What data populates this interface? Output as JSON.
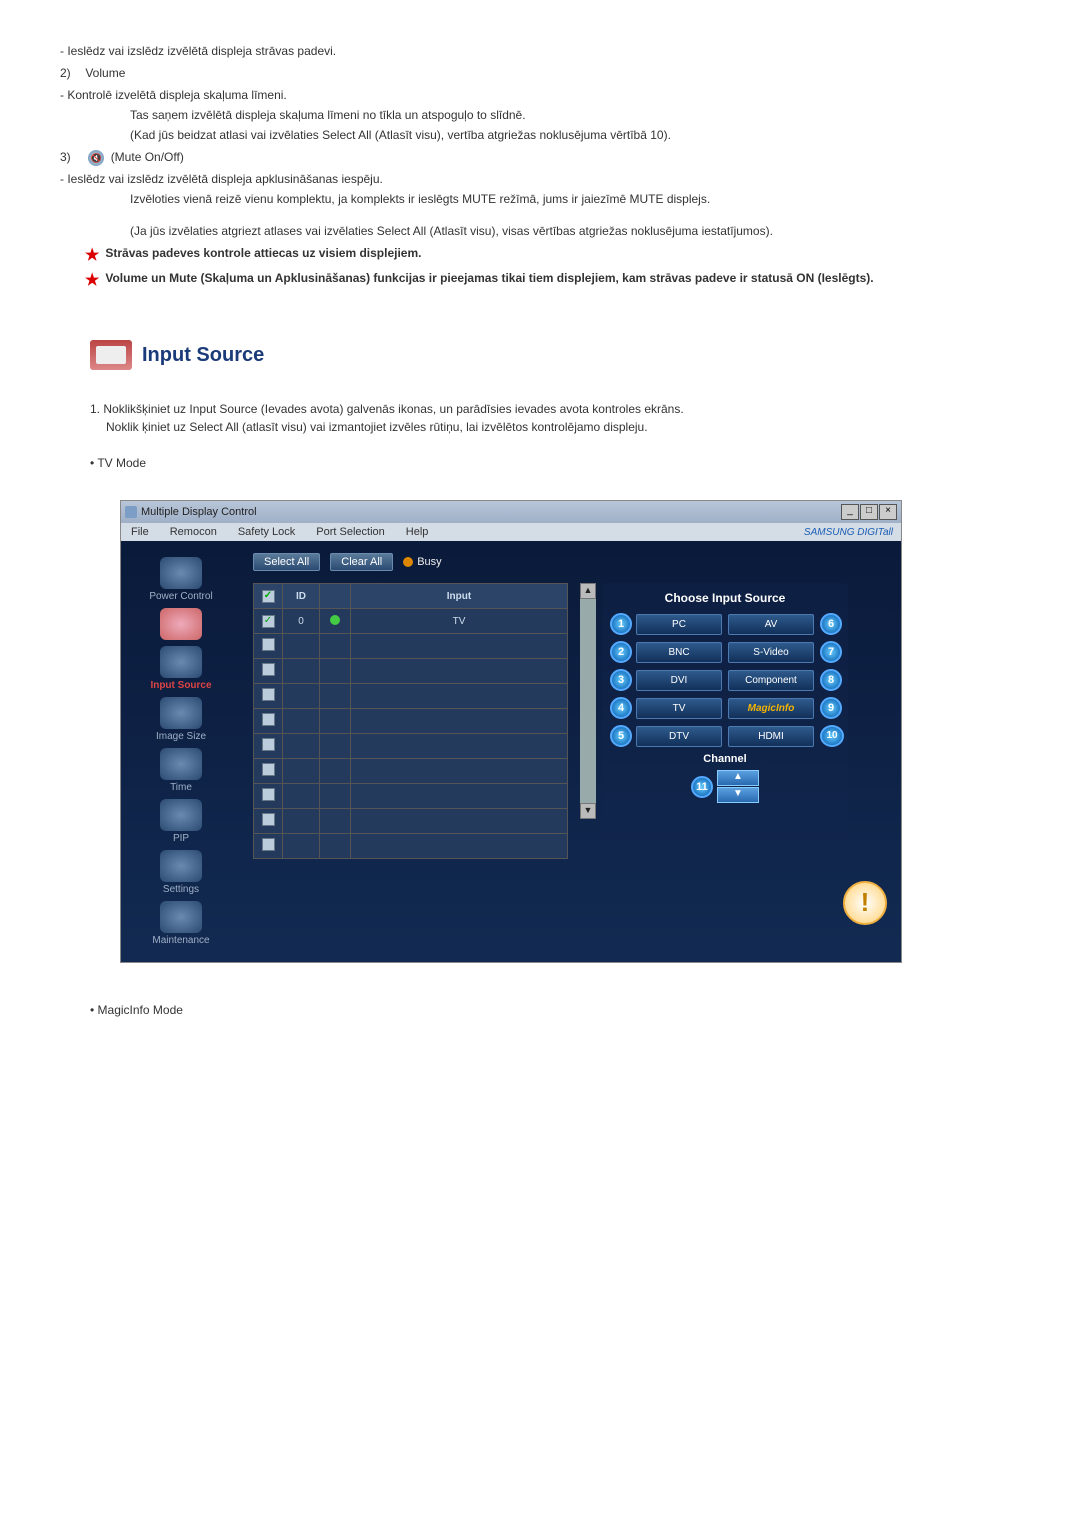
{
  "top_items": {
    "item1_dash": "- Ieslēdz vai izslēdz izvēlētā displeja strāvas padevi.",
    "vol_num": "2)",
    "vol_label": "Volume",
    "vol_line1": "- Kontrolē izvelētā displeja skaļuma līmeni.",
    "vol_line2": "Tas saņem izvēlētā displeja skaļuma līmeni no tīkla un atspoguļo to slīdnē.",
    "vol_line3": "(Kad jūs beidzat atlasi vai izvēlaties Select All (Atlasīt visu), vertība atgriežas noklusējuma vērtībā 10).",
    "mute_num": "3)",
    "mute_label": "(Mute On/Off)",
    "mute_line1": "- Ieslēdz vai izslēdz izvēlētā displeja apklusināšanas iespēju.",
    "mute_line2": "Izvēloties vienā reizē vienu komplektu, ja komplekts ir ieslēgts MUTE režīmā, jums ir jaiezīmē MUTE displejs.",
    "mute_line3": "(Ja jūs izvēlaties atgriezt atlases vai izvēlaties Select All (Atlasīt visu), visas vērtības atgriežas noklusējuma iestatījumos).",
    "star1": "Strāvas padeves kontrole attiecas uz visiem displejiem.",
    "star2": "Volume un Mute (Skaļuma un Apklusināšanas) funkcijas ir pieejamas tikai tiem displejiem, kam strāvas padeve ir statusā ON (Ieslēgts)."
  },
  "section": {
    "title": "Input Source",
    "step1_num": "1.",
    "step1_a": "Noklikšķiniet uz Input Source (Ievades avota) galvenās ikonas, un parādīsies ievades avota kontroles ekrāns.",
    "step1_b": "Noklik   ķiniet uz Select All (atlasīt visu) vai izmantojiet izvēles rūtiņu, lai izvēlētos kontrolējamo displeju.",
    "bullet_tv": "• TV Mode",
    "bullet_magic": "• MagicInfo Mode"
  },
  "app": {
    "title": "Multiple Display Control",
    "menus": [
      "File",
      "Remocon",
      "Safety Lock",
      "Port Selection",
      "Help"
    ],
    "brand": "SAMSUNG DIGITall",
    "sidebar": [
      "Power Control",
      "",
      "Input Source",
      "Image Size",
      "Time",
      "PIP",
      "Settings",
      "Maintenance"
    ],
    "sidebar_second": "",
    "select_all": "Select All",
    "clear_all": "Clear All",
    "busy": "Busy",
    "grid_headers": {
      "id": "ID",
      "input": "Input"
    },
    "grid_first_row": {
      "id": "0",
      "input": "TV"
    },
    "right": {
      "title": "Choose Input Source",
      "left": [
        "PC",
        "BNC",
        "DVI",
        "TV",
        "DTV"
      ],
      "right": [
        "AV",
        "S-Video",
        "Component",
        "MagicInfo",
        "HDMI"
      ],
      "channel": "Channel"
    },
    "callouts": {
      "left": [
        "1",
        "2",
        "3",
        "4",
        "5"
      ],
      "right": [
        "6",
        "7",
        "8",
        "9",
        "10"
      ],
      "channel": "11"
    }
  }
}
